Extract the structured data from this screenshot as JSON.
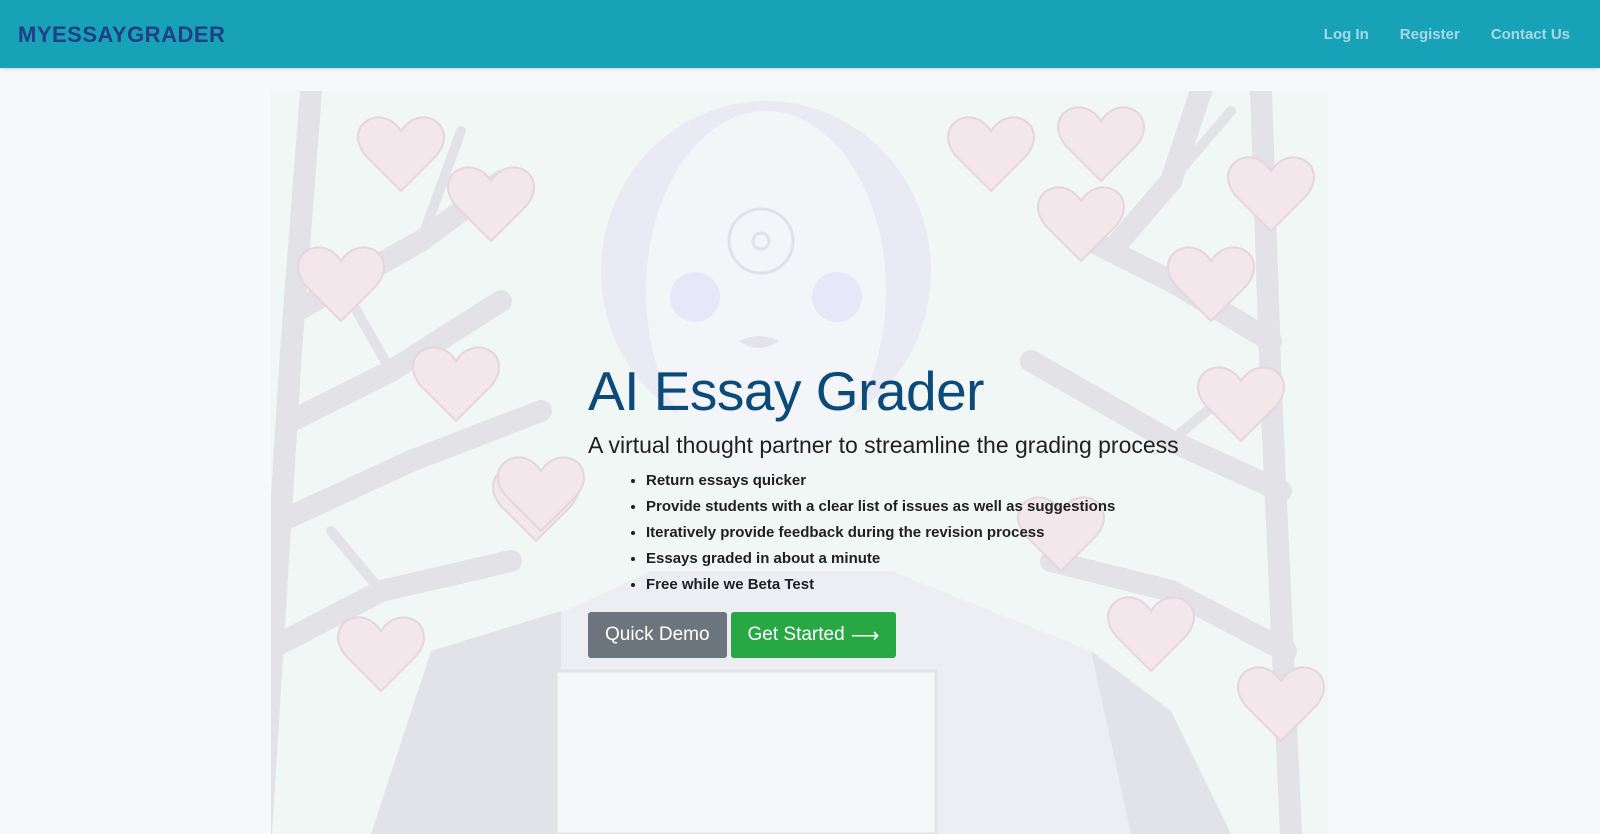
{
  "brand": {
    "name": "MYESSAYGRADER"
  },
  "nav": {
    "links": [
      "Log In",
      "Register",
      "Contact Us"
    ]
  },
  "hero": {
    "title": "AI Essay Grader",
    "subtitle": "A virtual thought partner to streamline the grading process",
    "features": [
      "Return essays quicker",
      "Provide students with a clear list of issues as well as suggestions",
      "Iteratively provide feedback during the revision process",
      "Essays graded in about a minute",
      "Free while we Beta Test"
    ],
    "buttons": {
      "demo": "Quick Demo",
      "start": "Get Started",
      "start_icon": "right-arrow-icon"
    },
    "illustration": "robot-holding-paper-with-heart-trees"
  },
  "colors": {
    "navbar": "#17a2b8",
    "title": "#0c4a7a",
    "demo_button": "#6c757d",
    "start_button": "#28a745"
  }
}
